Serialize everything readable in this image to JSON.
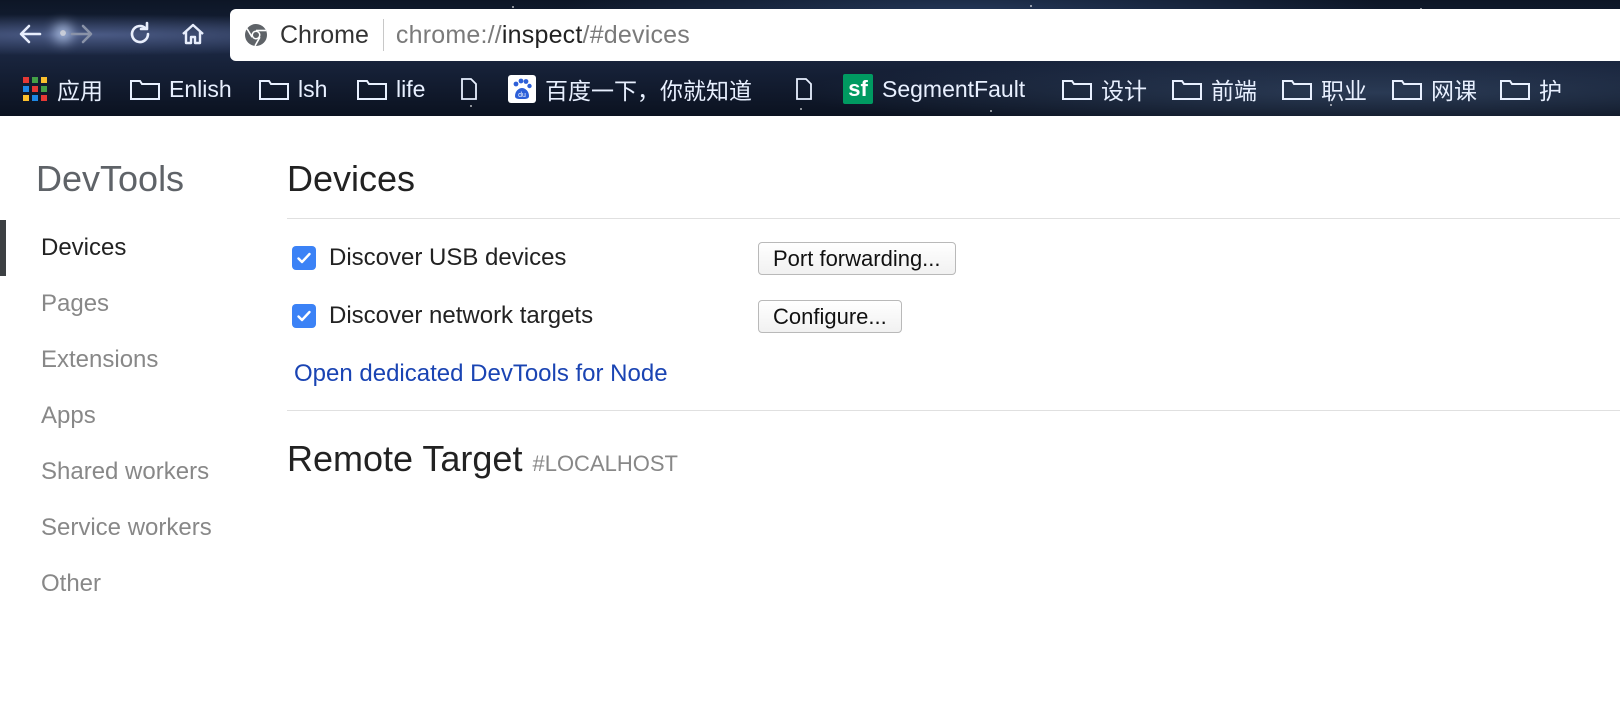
{
  "browser": {
    "omnibox": {
      "site_label": "Chrome",
      "url_prefix": "chrome://",
      "url_host": "inspect",
      "url_suffix": "/#devices"
    },
    "bookmarks": [
      {
        "label": "应用",
        "icon": "apps-grid-icon"
      },
      {
        "label": "Enlish",
        "icon": "folder-icon"
      },
      {
        "label": "lsh",
        "icon": "folder-icon"
      },
      {
        "label": "life",
        "icon": "folder-icon"
      },
      {
        "label": "",
        "icon": "file-icon"
      },
      {
        "label": "百度一下，你就知道",
        "icon": "baidu-icon"
      },
      {
        "label": "",
        "icon": "file-icon"
      },
      {
        "label": "SegmentFault",
        "icon": "segmentfault-icon"
      },
      {
        "label": "设计",
        "icon": "folder-icon"
      },
      {
        "label": "前端",
        "icon": "folder-icon"
      },
      {
        "label": "职业",
        "icon": "folder-icon"
      },
      {
        "label": "网课",
        "icon": "folder-icon"
      },
      {
        "label": "护",
        "icon": "folder-icon"
      }
    ],
    "baidu_glyph": "du",
    "sf_glyph": "sf"
  },
  "sidebar": {
    "title": "DevTools",
    "items": [
      {
        "label": "Devices",
        "active": true
      },
      {
        "label": "Pages",
        "active": false
      },
      {
        "label": "Extensions",
        "active": false
      },
      {
        "label": "Apps",
        "active": false
      },
      {
        "label": "Shared workers",
        "active": false
      },
      {
        "label": "Service workers",
        "active": false
      },
      {
        "label": "Other",
        "active": false
      }
    ]
  },
  "main": {
    "title": "Devices",
    "options": [
      {
        "label": "Discover USB devices",
        "checked": true,
        "button": "Port forwarding..."
      },
      {
        "label": "Discover network targets",
        "checked": true,
        "button": "Configure..."
      }
    ],
    "node_link": "Open dedicated DevTools for Node",
    "remote_title": "Remote Target",
    "remote_sub": "#LOCALHOST"
  },
  "colors": {
    "accent_checkbox": "#3b82f6",
    "link": "#1a44b3",
    "active_bar": "#3c4043"
  }
}
